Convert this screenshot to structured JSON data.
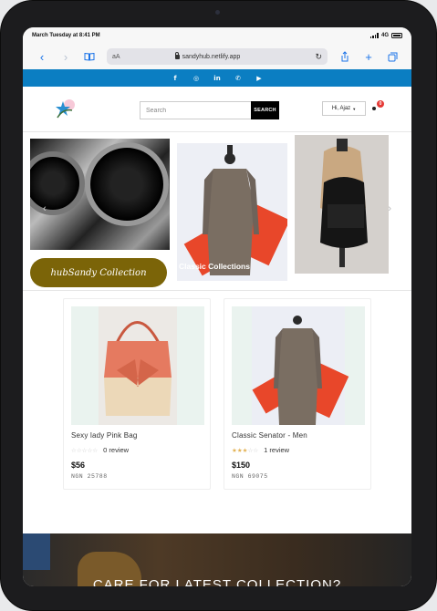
{
  "statusbar": {
    "time": "March Tuesday at 8:41 PM",
    "network": "4G"
  },
  "browser": {
    "aa": "aA",
    "url": "sandyhub.netlify.app"
  },
  "social": {
    "icons": [
      "facebook-icon",
      "instagram-icon",
      "linkedin-icon",
      "whatsapp-icon",
      "youtube-icon"
    ],
    "glyphs": [
      "f",
      "◎",
      "in",
      "✆",
      "▶"
    ]
  },
  "header": {
    "search_placeholder": "Search",
    "search_button": "SEARCH",
    "user_label": "Hi, Ajaz",
    "cart_count": "0"
  },
  "hero": {
    "caption_pill": "hubSandy Collection",
    "caption_classic": "Classic Collections"
  },
  "products": [
    {
      "name": "Sexy lady Pink Bag",
      "rating_stars": 0,
      "reviews": "0 review",
      "price": "$56",
      "ngn": "NGN 25788"
    },
    {
      "name": "Classic Senator - Men",
      "rating_stars": 3,
      "reviews": "1 review",
      "price": "$150",
      "ngn": "NGN 69075"
    }
  ],
  "banner": {
    "text": "CARE FOR LATEST COLLECTION?"
  },
  "colors": {
    "social_bar": "#0b7ec2",
    "caption_pill": "#7b6408",
    "star": "#e3b356",
    "badge": "#e53935"
  }
}
